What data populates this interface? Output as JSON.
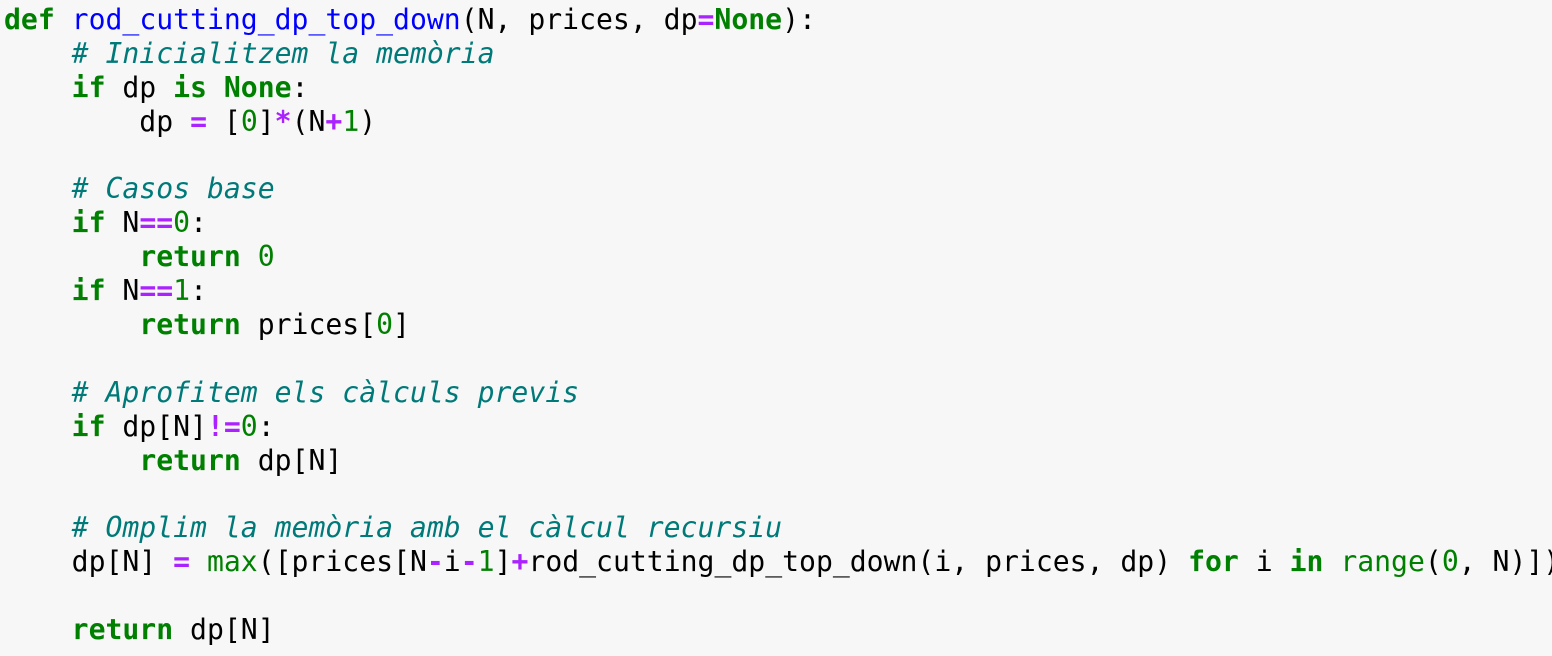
{
  "code": {
    "lines": [
      [
        {
          "t": "def",
          "c": "kw"
        },
        {
          "t": " ",
          "c": "tx"
        },
        {
          "t": "rod_cutting_dp_top_down",
          "c": "fn"
        },
        {
          "t": "(N, prices, dp",
          "c": "tx"
        },
        {
          "t": "=",
          "c": "op"
        },
        {
          "t": "None",
          "c": "kw"
        },
        {
          "t": "):",
          "c": "tx"
        }
      ],
      [
        {
          "t": "    ",
          "c": "tx"
        },
        {
          "t": "# Inicialitzem la memòria",
          "c": "cm"
        }
      ],
      [
        {
          "t": "    ",
          "c": "tx"
        },
        {
          "t": "if",
          "c": "kw"
        },
        {
          "t": " dp ",
          "c": "tx"
        },
        {
          "t": "is",
          "c": "kw"
        },
        {
          "t": " ",
          "c": "tx"
        },
        {
          "t": "None",
          "c": "kw"
        },
        {
          "t": ":",
          "c": "tx"
        }
      ],
      [
        {
          "t": "        dp ",
          "c": "tx"
        },
        {
          "t": "=",
          "c": "op"
        },
        {
          "t": " [",
          "c": "tx"
        },
        {
          "t": "0",
          "c": "num"
        },
        {
          "t": "]",
          "c": "tx"
        },
        {
          "t": "*",
          "c": "op"
        },
        {
          "t": "(N",
          "c": "tx"
        },
        {
          "t": "+",
          "c": "op"
        },
        {
          "t": "1",
          "c": "num"
        },
        {
          "t": ")",
          "c": "tx"
        }
      ],
      [],
      [
        {
          "t": "    ",
          "c": "tx"
        },
        {
          "t": "# Casos base",
          "c": "cm"
        }
      ],
      [
        {
          "t": "    ",
          "c": "tx"
        },
        {
          "t": "if",
          "c": "kw"
        },
        {
          "t": " N",
          "c": "tx"
        },
        {
          "t": "==",
          "c": "op"
        },
        {
          "t": "0",
          "c": "num"
        },
        {
          "t": ":",
          "c": "tx"
        }
      ],
      [
        {
          "t": "        ",
          "c": "tx"
        },
        {
          "t": "return",
          "c": "kw"
        },
        {
          "t": " ",
          "c": "tx"
        },
        {
          "t": "0",
          "c": "num"
        }
      ],
      [
        {
          "t": "    ",
          "c": "tx"
        },
        {
          "t": "if",
          "c": "kw"
        },
        {
          "t": " N",
          "c": "tx"
        },
        {
          "t": "==",
          "c": "op"
        },
        {
          "t": "1",
          "c": "num"
        },
        {
          "t": ":",
          "c": "tx"
        }
      ],
      [
        {
          "t": "        ",
          "c": "tx"
        },
        {
          "t": "return",
          "c": "kw"
        },
        {
          "t": " prices[",
          "c": "tx"
        },
        {
          "t": "0",
          "c": "num"
        },
        {
          "t": "]",
          "c": "tx"
        }
      ],
      [],
      [
        {
          "t": "    ",
          "c": "tx"
        },
        {
          "t": "# Aprofitem els càlculs previs",
          "c": "cm"
        }
      ],
      [
        {
          "t": "    ",
          "c": "tx"
        },
        {
          "t": "if",
          "c": "kw"
        },
        {
          "t": " dp[N]",
          "c": "tx"
        },
        {
          "t": "!=",
          "c": "op"
        },
        {
          "t": "0",
          "c": "num"
        },
        {
          "t": ":",
          "c": "tx"
        }
      ],
      [
        {
          "t": "        ",
          "c": "tx"
        },
        {
          "t": "return",
          "c": "kw"
        },
        {
          "t": " dp[N]",
          "c": "tx"
        }
      ],
      [],
      [
        {
          "t": "    ",
          "c": "tx"
        },
        {
          "t": "# Omplim la memòria amb el càlcul recursiu",
          "c": "cm"
        }
      ],
      [
        {
          "t": "    dp[N] ",
          "c": "tx"
        },
        {
          "t": "=",
          "c": "op"
        },
        {
          "t": " ",
          "c": "tx"
        },
        {
          "t": "max",
          "c": "bi"
        },
        {
          "t": "([prices[N",
          "c": "tx"
        },
        {
          "t": "-",
          "c": "op"
        },
        {
          "t": "i",
          "c": "tx"
        },
        {
          "t": "-",
          "c": "op"
        },
        {
          "t": "1",
          "c": "num"
        },
        {
          "t": "]",
          "c": "tx"
        },
        {
          "t": "+",
          "c": "op"
        },
        {
          "t": "rod_cutting_dp_top_down(i, prices, dp) ",
          "c": "tx"
        },
        {
          "t": "for",
          "c": "kw"
        },
        {
          "t": " i ",
          "c": "tx"
        },
        {
          "t": "in",
          "c": "kw"
        },
        {
          "t": " ",
          "c": "tx"
        },
        {
          "t": "range",
          "c": "bi"
        },
        {
          "t": "(",
          "c": "tx"
        },
        {
          "t": "0",
          "c": "num"
        },
        {
          "t": ", N)])",
          "c": "tx"
        }
      ],
      [],
      [
        {
          "t": "    ",
          "c": "tx"
        },
        {
          "t": "return",
          "c": "kw"
        },
        {
          "t": " dp[N]",
          "c": "tx"
        }
      ]
    ]
  }
}
